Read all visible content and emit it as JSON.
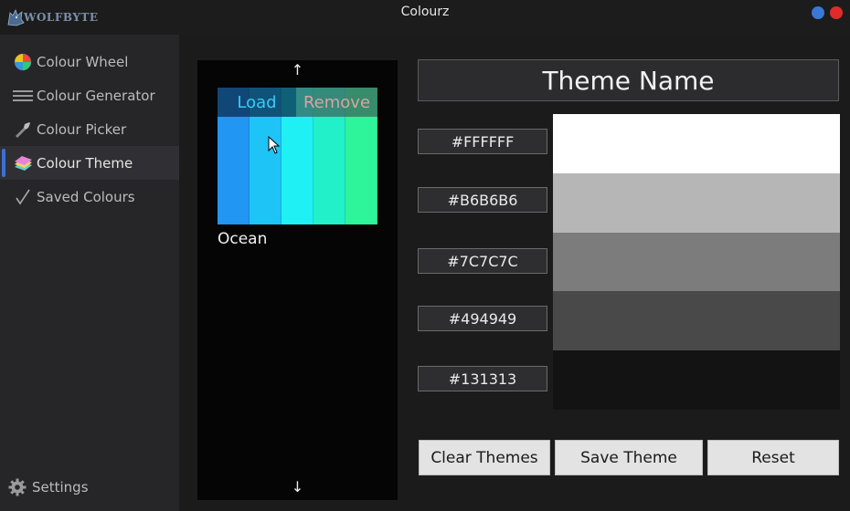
{
  "window": {
    "title": "Colourz",
    "logo_text": "WOLFBYTE"
  },
  "sidebar": {
    "items": [
      {
        "label": "Colour Wheel",
        "icon": "colour-wheel-icon"
      },
      {
        "label": "Colour Generator",
        "icon": "lines-icon"
      },
      {
        "label": "Colour Picker",
        "icon": "eyedropper-icon"
      },
      {
        "label": "Colour Theme",
        "icon": "palette-stack-icon",
        "active": true
      },
      {
        "label": "Saved Colours",
        "icon": "checkmark-icon"
      }
    ],
    "settings_label": "Settings",
    "accent_color": "#3d6fd9"
  },
  "theme_list": {
    "up_arrow": "↑",
    "down_arrow": "↓",
    "themes": [
      {
        "name": "Ocean",
        "load_label": "Load",
        "remove_label": "Remove",
        "colors": [
          "#2196f3",
          "#1ec4f6",
          "#1ff0f4",
          "#22f0c8",
          "#2ef59a"
        ]
      }
    ]
  },
  "editor": {
    "theme_name_placeholder": "Theme Name",
    "colors": [
      {
        "hex": "#FFFFFF",
        "value": "#ffffff"
      },
      {
        "hex": "#B6B6B6",
        "value": "#b6b6b6"
      },
      {
        "hex": "#7C7C7C",
        "value": "#7c7c7c"
      },
      {
        "hex": "#494949",
        "value": "#494949"
      },
      {
        "hex": "#131313",
        "value": "#131313"
      }
    ]
  },
  "actions": {
    "clear_label": "Clear Themes",
    "save_label": "Save Theme",
    "reset_label": "Reset"
  }
}
